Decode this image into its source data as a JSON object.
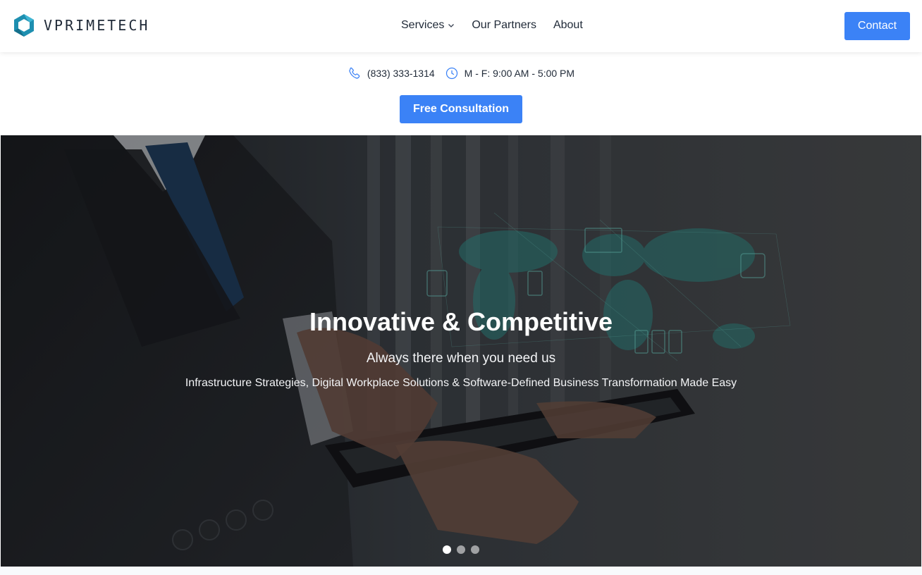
{
  "header": {
    "logo_text": "VPRIMETECH",
    "nav": [
      {
        "label": "Services",
        "has_dropdown": true
      },
      {
        "label": "Our Partners",
        "has_dropdown": false
      },
      {
        "label": "About",
        "has_dropdown": false
      }
    ],
    "contact_label": "Contact"
  },
  "info": {
    "phone": "(833) 333-1314",
    "hours": "M - F: 9:00 AM - 5:00 PM",
    "cta_label": "Free Consultation"
  },
  "hero": {
    "title": "Innovative & Competitive",
    "subtitle": "Always there when you need us",
    "description": "Infrastructure Strategies, Digital Workplace Solutions & Software-Defined Business Transformation Made Easy",
    "slides_count": 3,
    "active_slide": 1
  },
  "colors": {
    "accent": "#3b82f6",
    "logo_teal": "#1e8fb0",
    "text": "#1f2937"
  }
}
